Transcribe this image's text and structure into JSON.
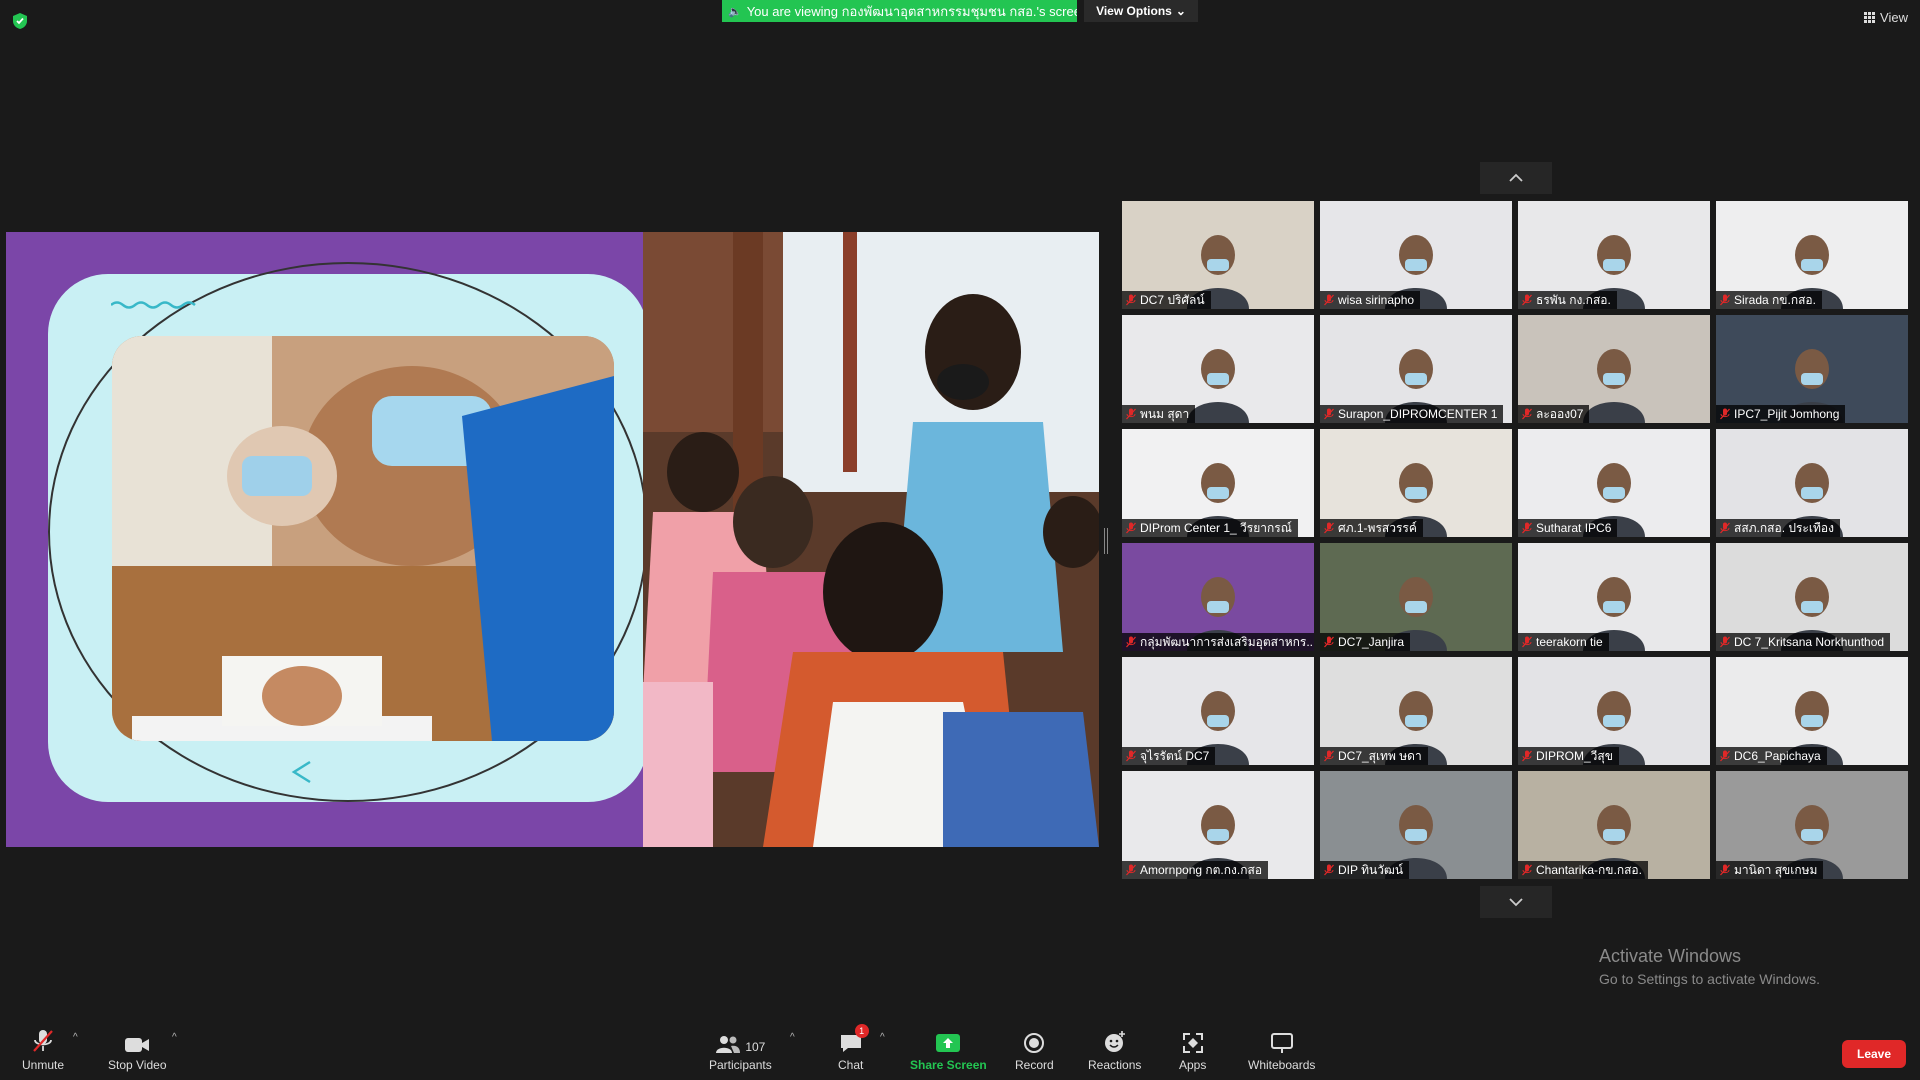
{
  "top": {
    "share_banner": "You are viewing กองพัฒนาอุตสาหกรรมชุมชน กสอ.'s screen",
    "view_options": "View Options",
    "view": "View"
  },
  "gallery": {
    "participants": [
      {
        "name": "DC7 ปริศัลน์",
        "bg": "#d9d2c6"
      },
      {
        "name": "wisa sirinapho",
        "bg": "#e6e6e9"
      },
      {
        "name": "ธรพัน กง.กสอ.",
        "bg": "#e8e8ea"
      },
      {
        "name": "Sirada กข.กสอ.",
        "bg": "#eeeeef"
      },
      {
        "name": "พนม สุดา",
        "bg": "#e9e9eb"
      },
      {
        "name": "Surapon_DIPROMCENTER 1",
        "bg": "#e4e4e7"
      },
      {
        "name": "ละออง07",
        "bg": "#c9c3bb"
      },
      {
        "name": "IPC7_Pijit Jomhong",
        "bg": "#3e4a5a"
      },
      {
        "name": "DIProm Center 1_ วีรยากรณ์",
        "bg": "#f1f1f2"
      },
      {
        "name": "ศภ.1-พรสวรรค์",
        "bg": "#e7e3dc"
      },
      {
        "name": "Sutharat IPC6",
        "bg": "#ececee"
      },
      {
        "name": "สสภ.กสอ. ประเทือง",
        "bg": "#e3e3e6"
      },
      {
        "name": "กลุ่มพัฒนาการส่งเสริมอุตสาหกร...",
        "bg": "#7a4aa0"
      },
      {
        "name": "DC7_Janjira",
        "bg": "#5e6a52"
      },
      {
        "name": "teerakorn tie",
        "bg": "#e8e8ea"
      },
      {
        "name": "DC 7_Kritsana Norkhunthod",
        "bg": "#dcdcdc"
      },
      {
        "name": "จุไรรัตน์ DC7",
        "bg": "#e6e6e9"
      },
      {
        "name": "DC7_สุเทพ ษดา",
        "bg": "#dedede"
      },
      {
        "name": "DIPROM_วีสุข",
        "bg": "#e3e3e6"
      },
      {
        "name": "DC6_Papichaya",
        "bg": "#ebebec"
      },
      {
        "name": "Amornpong กต.กง.กสอ",
        "bg": "#e9e9eb"
      },
      {
        "name": "DIP ทินวัฒน์",
        "bg": "#8a8f92"
      },
      {
        "name": "Chantarika-กข.กสอ.",
        "bg": "#b8b1a2"
      },
      {
        "name": "มานิดา สุขเกษม",
        "bg": "#9a9a9a"
      }
    ]
  },
  "watermark": {
    "title": "Activate Windows",
    "subtitle": "Go to Settings to activate Windows."
  },
  "toolbar": {
    "unmute": "Unmute",
    "stop_video": "Stop Video",
    "participants_count": "107",
    "participants": "Participants",
    "chat": "Chat",
    "chat_badge": "1",
    "share_screen": "Share Screen",
    "record": "Record",
    "reactions": "Reactions",
    "apps": "Apps",
    "whiteboards": "Whiteboards",
    "leave": "Leave"
  },
  "colors": {
    "share_green": "#23c552",
    "leave_red": "#e02828",
    "slide_purple": "#7b46a8"
  }
}
